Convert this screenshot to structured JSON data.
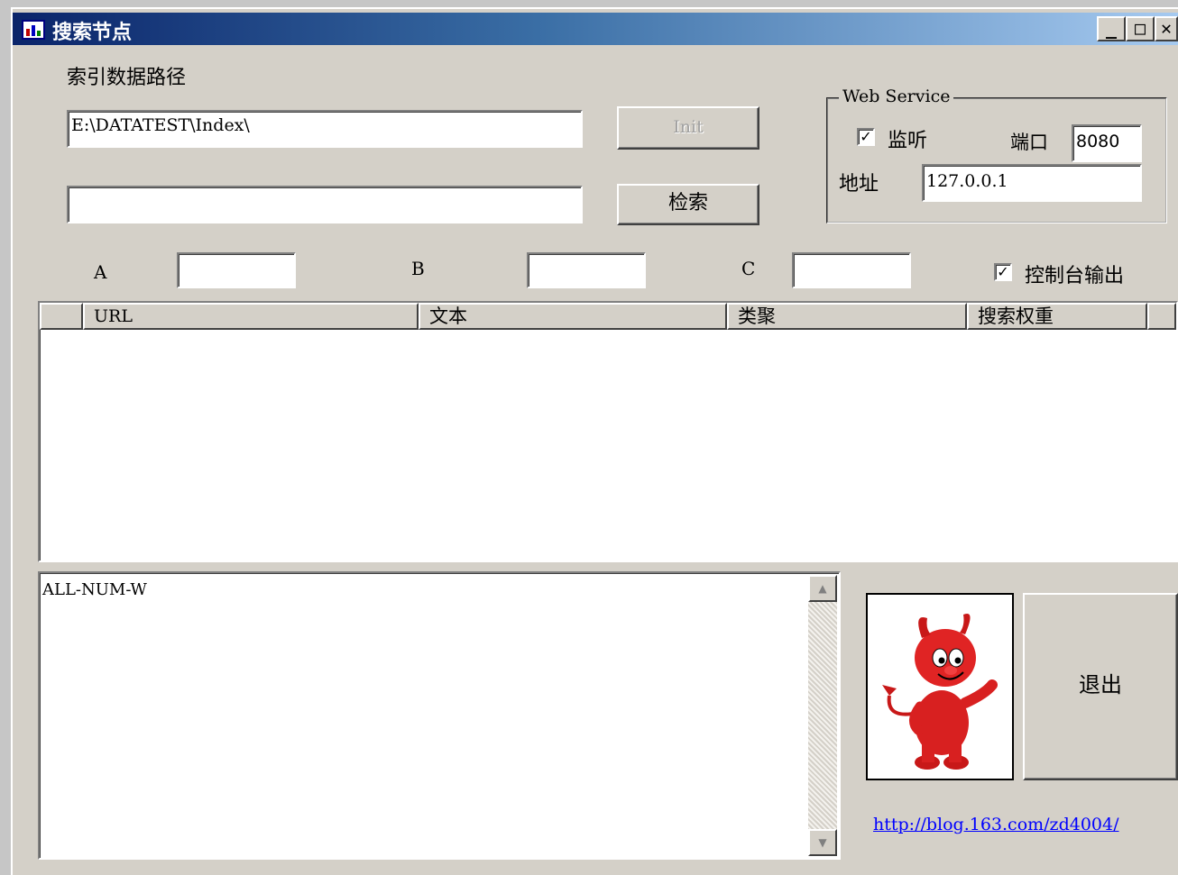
{
  "window": {
    "title": "搜索节点",
    "controls": {
      "minimize": "_",
      "maximize": "□",
      "close": "✕"
    }
  },
  "index_path": {
    "label": "索引数据路径",
    "value": "E:\\DATATEST\\Index\\"
  },
  "init_button": "Init",
  "search_input": {
    "value": ""
  },
  "search_button": "检索",
  "web_service": {
    "group_label": "Web Service",
    "listen_label": "监听",
    "listen_checked": true,
    "port_label": "端口",
    "port_value": "8080",
    "address_label": "地址",
    "address_value": "127.0.0.1"
  },
  "params": {
    "a_label": "A",
    "b_label": "B",
    "c_label": "C",
    "a_value": "",
    "b_value": "",
    "c_value": ""
  },
  "console_output": {
    "label": "控制台输出",
    "checked": true
  },
  "results_table": {
    "columns": [
      "URL",
      "文本",
      "类聚",
      "搜索权重"
    ],
    "rows": []
  },
  "log": {
    "text": "ALL-NUM-W"
  },
  "exit_button": "退出",
  "link": "http://blog.163.com/zd4004/",
  "colors": {
    "title_start": "#0a246a",
    "title_end": "#a6caf0",
    "face": "#d4d0c8",
    "link": "#0000ff"
  },
  "icons": {
    "app": "app-chart-icon",
    "mascot": "bsd-daemon-image"
  }
}
